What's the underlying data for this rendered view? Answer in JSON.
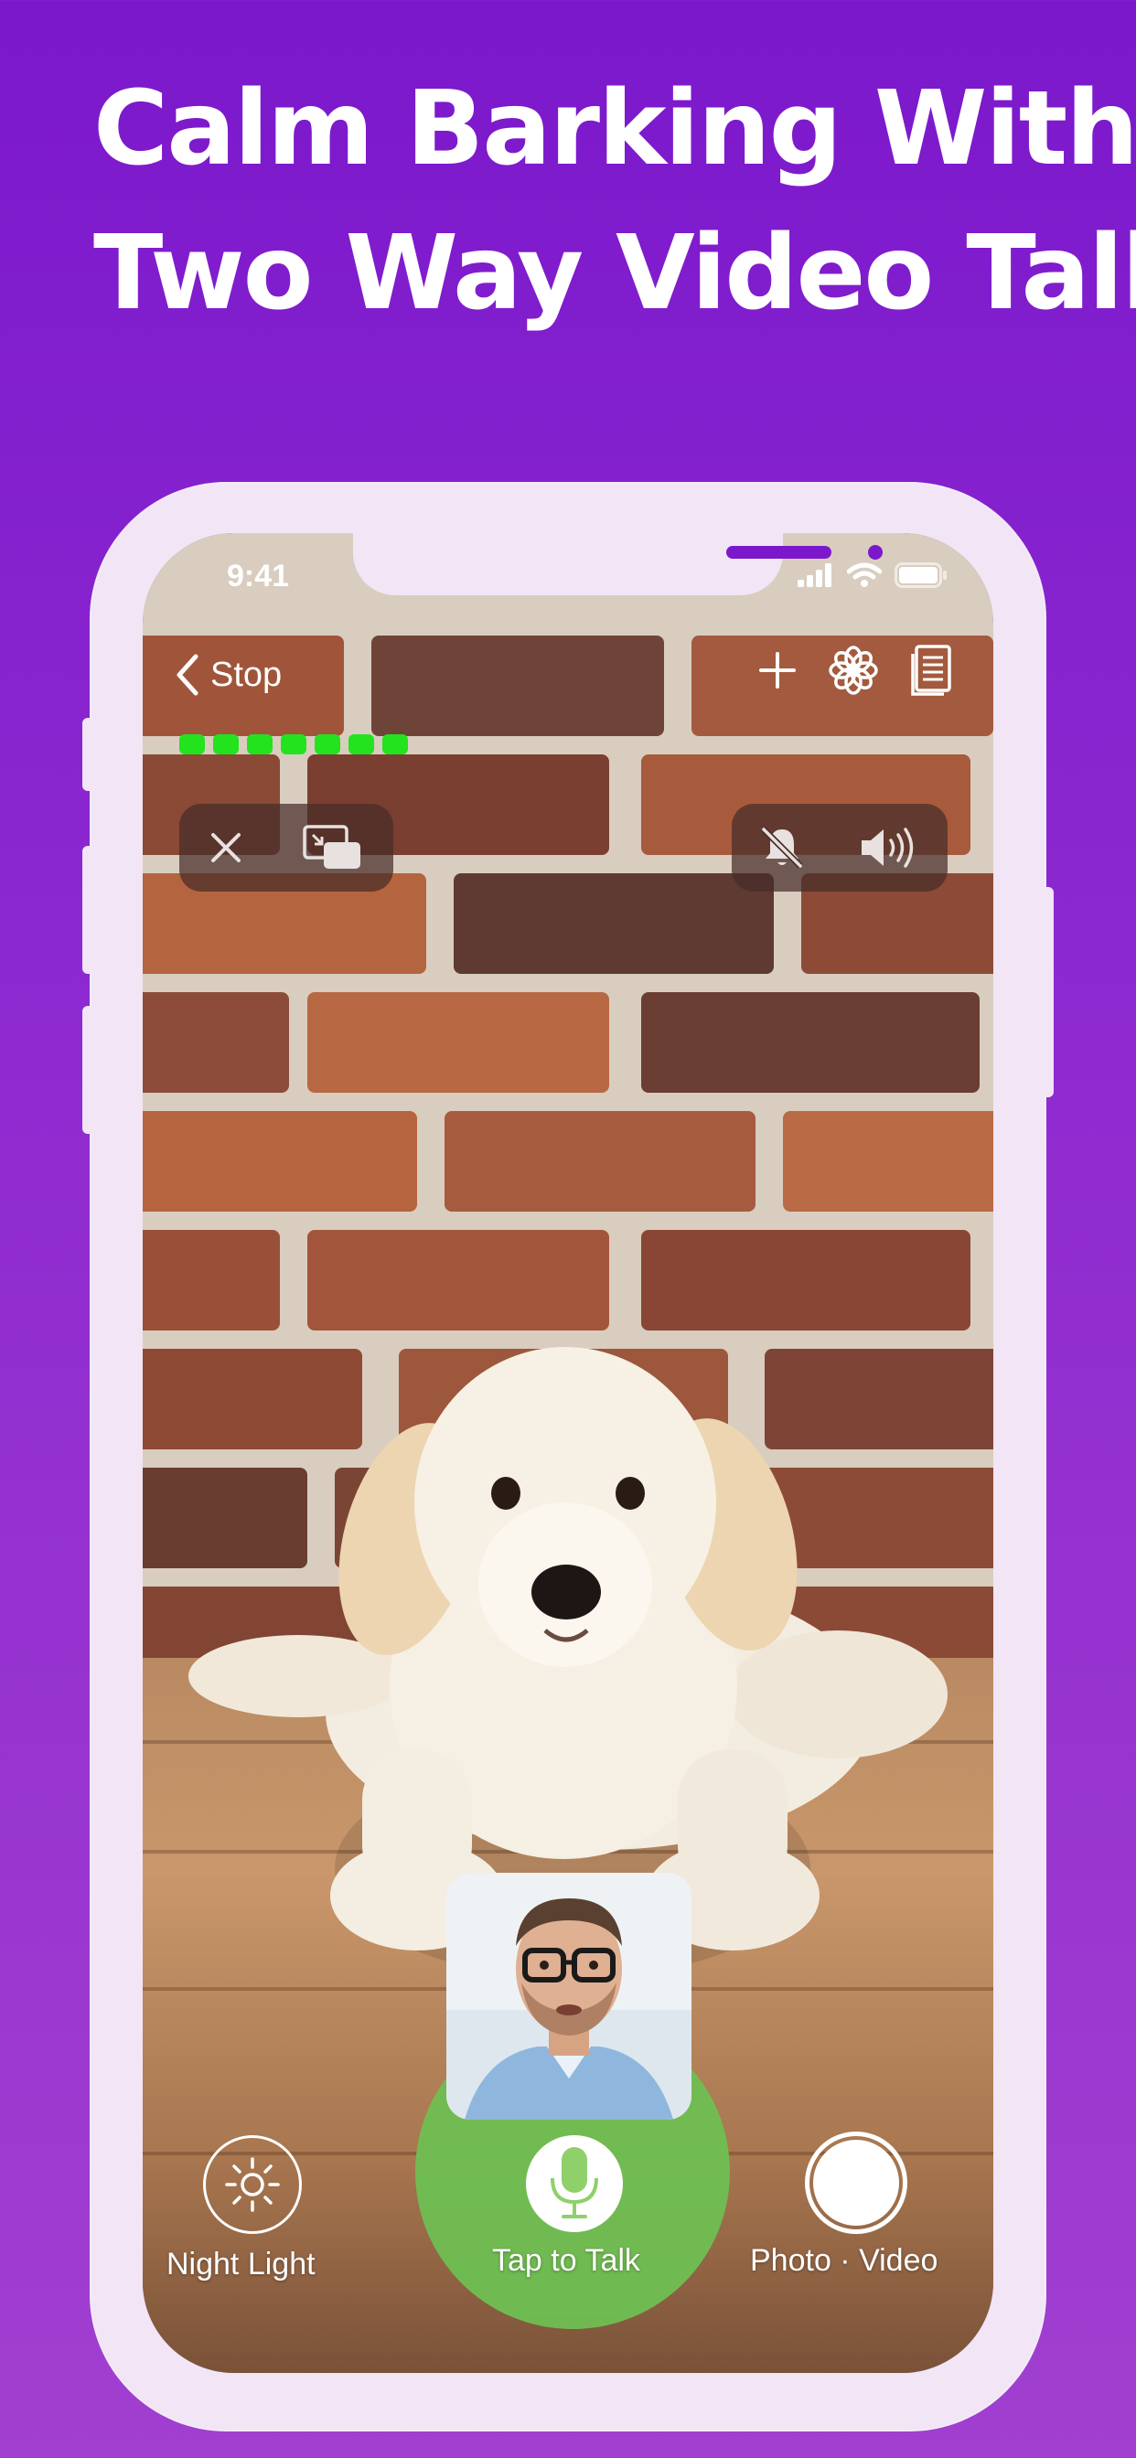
{
  "headline": {
    "line1": "Calm Barking With",
    "line2": "Two Way Video Talk"
  },
  "status_bar": {
    "time": "9:41",
    "icons": [
      "cellular-signal-icon",
      "wifi-icon",
      "battery-icon"
    ]
  },
  "nav": {
    "back_label": "Stop",
    "right_icons": [
      "plus-icon",
      "flower-icon",
      "document-icon"
    ]
  },
  "sound_level": {
    "active_segments": 7
  },
  "left_controls": {
    "icons": [
      "close-icon",
      "picture-in-picture-icon"
    ]
  },
  "right_controls": {
    "icons": [
      "bell-muted-icon",
      "speaker-icon"
    ]
  },
  "bottom": {
    "night_light_label": "Night Light",
    "talk_label": "Tap to Talk",
    "photo_video_label": "Photo · Video"
  },
  "colors": {
    "background_top": "#7b18cc",
    "background_bottom": "#a13fd0",
    "device_frame": "#f1e5f6",
    "level_green": "#22e31e",
    "talk_green": "#6fbf53"
  }
}
